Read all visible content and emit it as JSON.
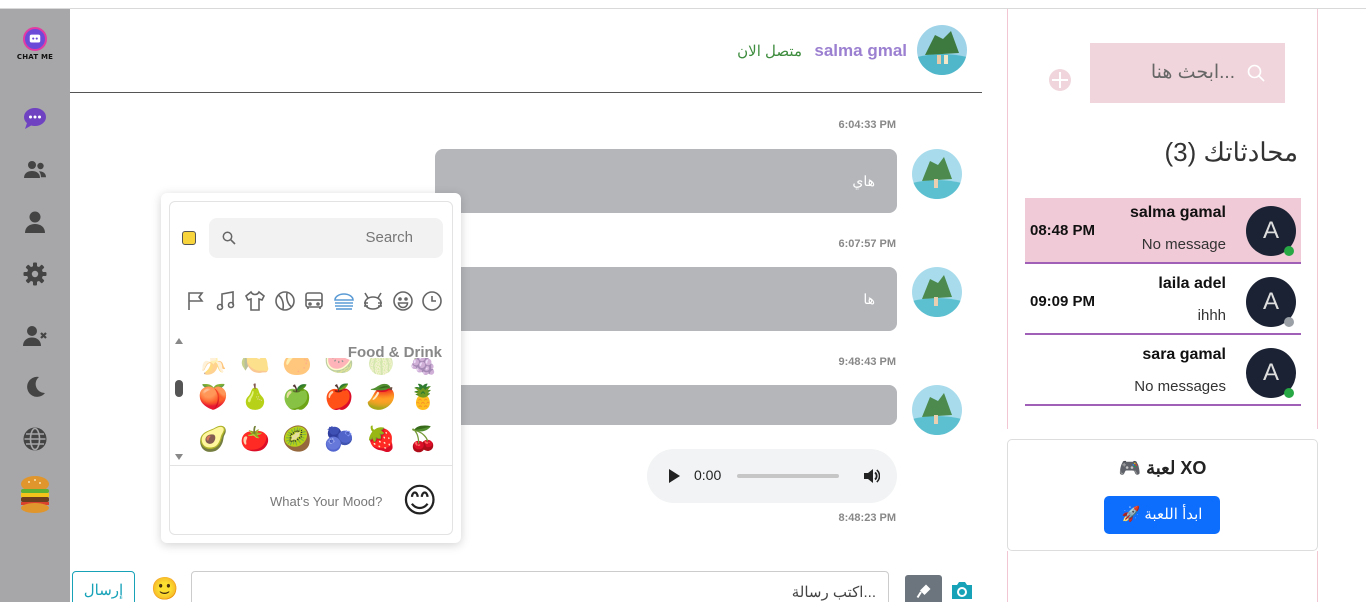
{
  "app": {
    "logo_text": "CHAT ME"
  },
  "header": {
    "name": "salma gmal",
    "status": "متصل الان"
  },
  "messages": [
    {
      "time": "6:04:33 PM"
    },
    {
      "text": "هاي",
      "time": "6:07:57 PM"
    },
    {
      "text": "ها",
      "time": "9:48:43 PM"
    },
    {
      "text": ""
    },
    {
      "audio_time": "0:00",
      "time": "8:48:23 PM"
    }
  ],
  "emoji_picker": {
    "search_placeholder": "Search",
    "category_title": "Food & Drink",
    "categories": [
      "recent-icon",
      "smileys-icon",
      "animals-icon",
      "food-icon",
      "travel-icon",
      "activities-icon",
      "objects-icon",
      "symbols-icon",
      "flags-icon"
    ],
    "faded_row": [
      "🍌",
      "🍋",
      "🍊",
      "🍉",
      "🍈",
      "🍇"
    ],
    "rows": [
      [
        "🍑",
        "🍐",
        "🍏",
        "🍎",
        "🥭",
        "🍍"
      ],
      [
        "🥑",
        "🍅",
        "🥝",
        "🫐",
        "🍓",
        "🍒"
      ]
    ],
    "mood_text": "What's Your Mood?",
    "mood_emoji": "😊"
  },
  "composer": {
    "send_label": "إرسال",
    "input_placeholder": "اكتب رسالة...",
    "emoji_button": "🙂"
  },
  "sidebar": {
    "search_placeholder": "ابحث هنا...",
    "title": "محادثاتك (3)",
    "conversations": [
      {
        "name": "salma gamal",
        "message": "No message",
        "time": "08:48 PM",
        "avatar": "A",
        "online": true
      },
      {
        "name": "laila adel",
        "message": "ihhh",
        "time": "09:09 PM",
        "avatar": "A",
        "online": false
      },
      {
        "name": "sara gamal",
        "message": "No messages",
        "time": "",
        "avatar": "A",
        "online": true
      }
    ]
  },
  "game": {
    "title": "🎮 لعبة XO",
    "button_label": "🚀 ابدأ اللعبة"
  },
  "colors": {
    "rail": "#a7a7a9",
    "accent_purple": "#9b7fd0",
    "status_green": "#3e8c3e",
    "bubble": "#b4b6ba",
    "active_conv": "#f0cad6",
    "primary_button": "#0d6efd",
    "online_dot": "#28a745",
    "offline_dot": "#9aa0a6"
  }
}
